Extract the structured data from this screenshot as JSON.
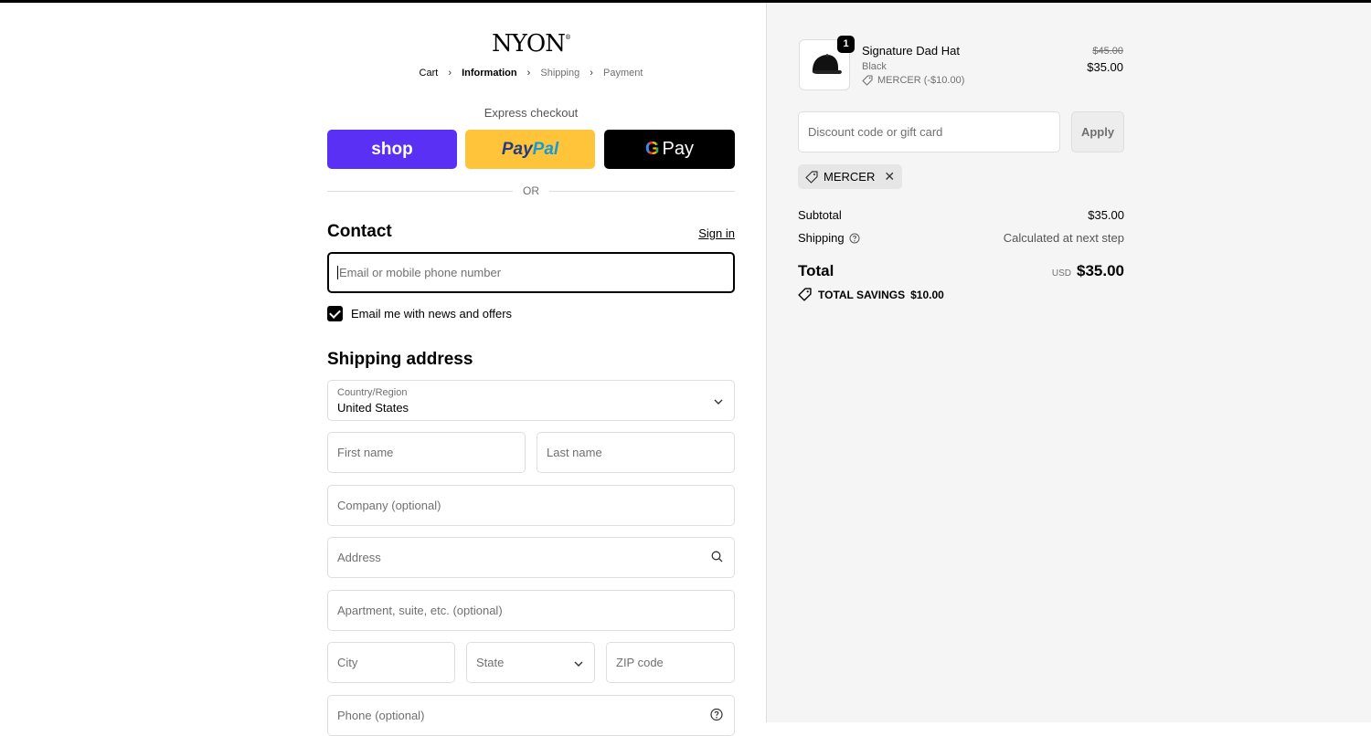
{
  "brand": {
    "logo": "NYON",
    "trademark": "®"
  },
  "breadcrumb": [
    "Cart",
    "Information",
    "Shipping",
    "Payment"
  ],
  "express": {
    "title": "Express checkout",
    "shop_label": "shop",
    "paypal_label_1": "Pay",
    "paypal_label_2": "Pal",
    "gpay_g": "G",
    "gpay_label": "Pay",
    "or_label": "OR"
  },
  "contact": {
    "heading": "Contact",
    "signin_label": "Sign in",
    "email_placeholder": "Email or mobile phone number",
    "newsletter_label": "Email me with news and offers",
    "newsletter_checked": true
  },
  "shipping": {
    "heading": "Shipping address",
    "country_label": "Country/Region",
    "country_value": "United States",
    "first_name": "First name",
    "last_name": "Last name",
    "company": "Company (optional)",
    "address": "Address",
    "apartment": "Apartment, suite, etc. (optional)",
    "city": "City",
    "state": "State",
    "zip": "ZIP code",
    "phone": "Phone (optional)"
  },
  "summary": {
    "item": {
      "quantity": "1",
      "name": "Signature Dad Hat",
      "variant": "Black",
      "discount": "MERCER (-$10.00)",
      "original_price": "$45.00",
      "price": "$35.00"
    },
    "discount_placeholder": "Discount code or gift card",
    "apply_label": "Apply",
    "applied_code": "MERCER",
    "subtotal_label": "Subtotal",
    "subtotal_value": "$35.00",
    "shipping_label": "Shipping",
    "shipping_value": "Calculated at next step",
    "total_label": "Total",
    "currency": "USD",
    "total_value": "$35.00",
    "savings_label": "TOTAL SAVINGS",
    "savings_value": "$10.00"
  }
}
